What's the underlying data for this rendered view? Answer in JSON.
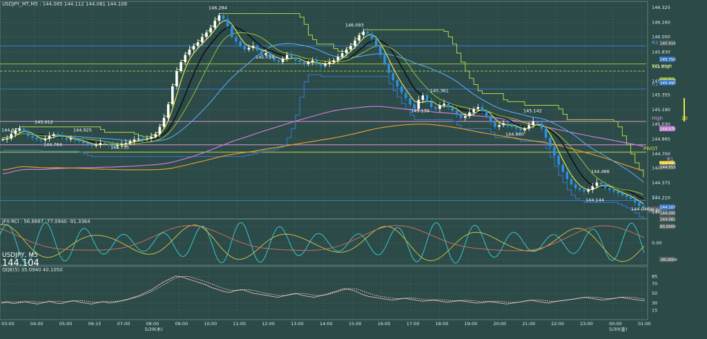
{
  "header": {
    "ohlc_label": "USDJPY_MT,M5 : 144.085 144.112 144.081 144.106",
    "symbol": "USDJPY, M5",
    "last_price": "144.104"
  },
  "colors": {
    "background": "#2b4a48",
    "grid": "#4d6a67",
    "candle_up": "#ffffff",
    "candle_down": "#2d8fe0",
    "ma_fast": "#e8e84a",
    "ma_mid": "#111111",
    "ma_slow": "#5aa0e8",
    "ma_long": "#e89a2a",
    "ma_very_long": "#d07ad8",
    "pivot_line": "#c8d84a",
    "resistance_line": "#3a7ad0",
    "step_upper": "#b6d84a",
    "step_lower": "#3a7ad0"
  },
  "chart_data": [
    {
      "type": "candlestick",
      "time_labels": [
        "03:00",
        "04:00",
        "05:00",
        "06:15",
        "07:00",
        "08:00",
        "09:00",
        "10:00",
        "11:00",
        "12:00",
        "13:00",
        "14:00",
        "15:00",
        "16:00",
        "17:00",
        "18:00",
        "19:00",
        "20:00",
        "21:00",
        "22:00",
        "23:00",
        "00:00",
        "01:00"
      ],
      "date_labels": [
        "5/29(木)",
        "5/30(金)"
      ],
      "y_axis_ticks": [
        146.325,
        146.16,
        146.0,
        145.83,
        145.67,
        145.51,
        145.355,
        145.19,
        145.03,
        144.865,
        144.7,
        144.54,
        144.375,
        144.21,
        144.05
      ],
      "ylim": [
        144.0,
        146.38
      ],
      "close_series": [
        144.86,
        144.87,
        144.92,
        144.96,
        144.98,
        144.95,
        144.9,
        144.88,
        144.86,
        144.85,
        144.87,
        144.9,
        144.92,
        144.9,
        144.88,
        144.86,
        144.87,
        144.85,
        144.84,
        144.82,
        144.8,
        144.79,
        144.8,
        144.82,
        144.81,
        144.8,
        144.79,
        144.8,
        144.81,
        144.82,
        144.84,
        144.86,
        144.87,
        144.86,
        144.87,
        144.89,
        144.92,
        145.0,
        145.1,
        145.25,
        145.45,
        145.62,
        145.72,
        145.8,
        145.86,
        145.9,
        145.94,
        146.0,
        146.05,
        146.1,
        146.18,
        146.24,
        146.2,
        146.12,
        146.0,
        145.95,
        145.9,
        145.86,
        145.88,
        145.9,
        145.85,
        145.8,
        145.82,
        145.78,
        145.74,
        145.72,
        145.76,
        145.8,
        145.77,
        145.74,
        145.72,
        145.7,
        145.72,
        145.74,
        145.7,
        145.68,
        145.7,
        145.72,
        145.74,
        145.78,
        145.82,
        145.86,
        145.9,
        145.96,
        146.02,
        146.06,
        146.04,
        145.98,
        145.9,
        145.8,
        145.7,
        145.6,
        145.52,
        145.45,
        145.38,
        145.32,
        145.25,
        145.2,
        145.3,
        145.35,
        145.28,
        145.22,
        145.2,
        145.24,
        145.26,
        145.22,
        145.18,
        145.14,
        145.1,
        145.12,
        145.16,
        145.2,
        145.22,
        145.18,
        145.12,
        145.06,
        145.0,
        145.02,
        145.04,
        145.02,
        145.0,
        144.98,
        144.96,
        144.98,
        145.02,
        145.06,
        145.04,
        144.98,
        144.88,
        144.78,
        144.68,
        144.58,
        144.5,
        144.42,
        144.36,
        144.32,
        144.3,
        144.28,
        144.3,
        144.34,
        144.38,
        144.36,
        144.32,
        144.3,
        144.28,
        144.26,
        144.24,
        144.22,
        144.2,
        144.16,
        144.12,
        144.1
      ],
      "price_labels": [
        {
          "text": "146.284",
          "x": 1,
          "y": 146.284
        },
        {
          "text": "146.093",
          "x": 2,
          "y": 146.093
        },
        {
          "text": "145.012",
          "x": 3,
          "y": 145.012
        },
        {
          "text": "144.925",
          "x": 4,
          "y": 144.925
        },
        {
          "text": "144.764",
          "x": 5,
          "y": 144.764
        },
        {
          "text": "144.735",
          "x": 6,
          "y": 144.735
        },
        {
          "text": "144.927",
          "x": 7,
          "y": 144.927
        },
        {
          "text": "145.734",
          "x": 8,
          "y": 145.734
        },
        {
          "text": "145.361",
          "x": 9,
          "y": 145.361
        },
        {
          "text": "145.139",
          "x": 10,
          "y": 145.139
        },
        {
          "text": "145.142",
          "x": 11,
          "y": 145.142
        },
        {
          "text": "144.880",
          "x": 12,
          "y": 144.88
        },
        {
          "text": "144.466",
          "x": 13,
          "y": 144.466
        },
        {
          "text": "144.144",
          "x": 14,
          "y": 144.144
        },
        {
          "text": "144.046",
          "x": 15,
          "y": 144.046
        }
      ],
      "pivot_labels": [
        "R2",
        "W1 High",
        "R1",
        "High",
        "PIVOT",
        "R1",
        "S1",
        "W-pp",
        "20"
      ],
      "right_axis_boxes": [
        "145.916",
        "145.750",
        "145.518",
        "145.490",
        "144.978",
        "144.590",
        "144.553",
        "144.107",
        "144.095",
        "144.081"
      ]
    },
    {
      "type": "line",
      "label": "JFX-RCI : 56.6667 -77.0940 -91.3364",
      "y_axis_ticks": [
        "0.00"
      ],
      "right_axis_boxes": [
        "80.0000",
        "-80.0000"
      ]
    },
    {
      "type": "line",
      "label": "QQE(5) 35.0940 40.1050",
      "y_axis_ticks": [
        85,
        70,
        50,
        30,
        15
      ],
      "ylim": [
        0,
        100
      ],
      "series_line": [
        30,
        32,
        29,
        31,
        33,
        30,
        28,
        31,
        34,
        30,
        29,
        33,
        35,
        32,
        30,
        28,
        31,
        33,
        30,
        32,
        35,
        38,
        42,
        46,
        52,
        58,
        66,
        74,
        80,
        86,
        84,
        80,
        76,
        72,
        68,
        62,
        58,
        54,
        52,
        56,
        58,
        54,
        50,
        48,
        46,
        44,
        42,
        45,
        48,
        50,
        46,
        44,
        42,
        45,
        48,
        52,
        56,
        60,
        58,
        54,
        48,
        44,
        42,
        40,
        38,
        36,
        38,
        40,
        38,
        36,
        34,
        35,
        36,
        34,
        32,
        33,
        35,
        34,
        32,
        30,
        31,
        33,
        32,
        30,
        28,
        30,
        32,
        34,
        36,
        34,
        32,
        30,
        33,
        35,
        36,
        38,
        40,
        42,
        40,
        38,
        36,
        38,
        40,
        42,
        40,
        38,
        36,
        35
      ]
    }
  ]
}
